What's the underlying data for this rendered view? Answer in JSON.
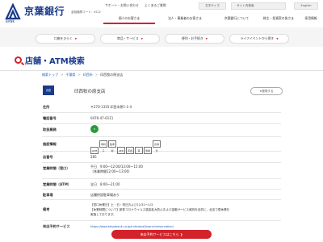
{
  "header": {
    "logo_text": "京葉銀行",
    "logo_sub": "BANK",
    "bank_code": "金融機関コード：0522",
    "util_links": [
      "サポート・お問い合わせ",
      "よくあるご質問"
    ],
    "font_size_label": "文字サイズ",
    "search_label": "サイト内検索",
    "lang_label": "English",
    "nav": [
      "個人のお客さま",
      "法人・事業者のお客さま",
      "京葉銀行について",
      "株主・投資家の皆さま",
      "採用情報"
    ]
  },
  "subnav": {
    "buttons": [
      "口座をひらく",
      "商品・サービス",
      "便利・お手続き",
      "ライフイベントから探す"
    ],
    "caret": "▼"
  },
  "page": {
    "title": "店舗・ATM検索",
    "breadcrumb": [
      "検索トップ",
      "千葉県",
      "印西市",
      "印西牧の原支店"
    ],
    "branch_badge": "京葉",
    "branch_name": "印西牧の原支店",
    "register_label": "★登録する"
  },
  "details": {
    "address_label": "住所",
    "address": "〒270-1335 印西市原1-1-4",
    "phone_label": "電話番号",
    "phone": "0476-47-6111",
    "services_label": "取扱業務",
    "facility_label": "施設情報",
    "facility_icons": [
      "ATM",
      "車椅子",
      "駐車場",
      "AED",
      "手話",
      "耳",
      "筆談",
      "盲導犬"
    ],
    "store_no_label": "店番号",
    "store_no": "285",
    "window_hours_label": "営業時間（窓口）",
    "window_hours_1": "平日　9:00～12:00/13:00～15:00",
    "window_hours_2": "（休業時間12:00～13:00）",
    "atm_hours_label": "営業時間（ATM）",
    "atm_hours": "全日　8:00～21:00",
    "parking_label": "駐車場",
    "parking": "店舗併設駐車場あり",
    "notes_label": "備考",
    "notes_1": "【窓口休業日】土・日・祝日および12/31～1/3",
    "notes_2": "【休業時間について】新型コロナウイルス感染拡大防止および金融サービス維持を目的に、全店で昼休業を",
    "notes_3": "実施しております。",
    "reservation_label": "来店予約サービス",
    "reservation_link": "https://www.keiyobank.co.jp/individual/branch/reservation/",
    "reservation_button": "来店予約サービスはこちら ❯"
  }
}
